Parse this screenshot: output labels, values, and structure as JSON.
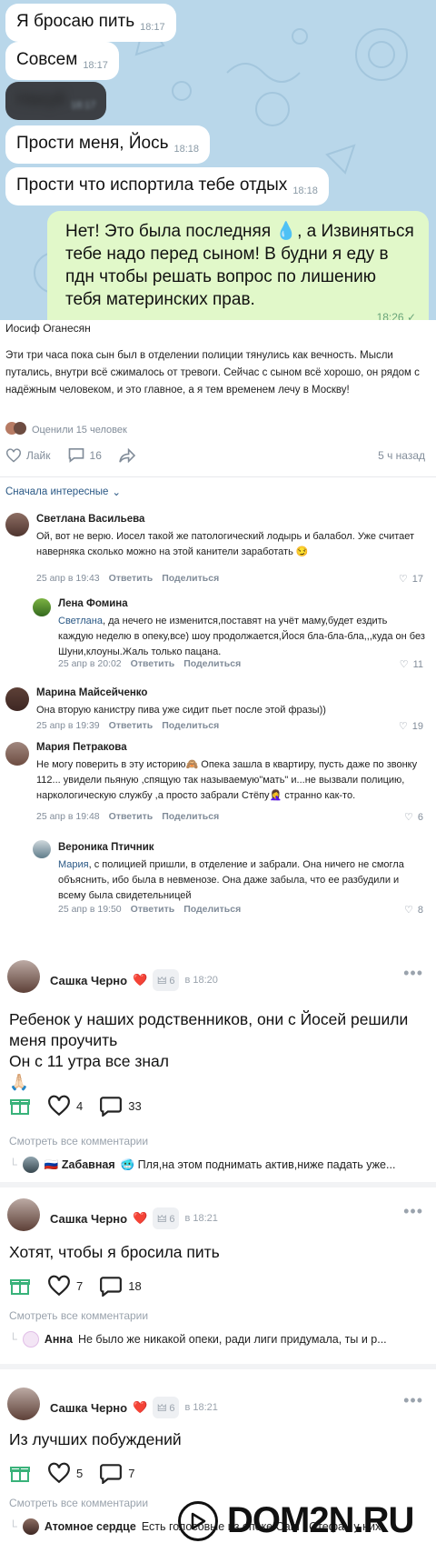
{
  "chat": {
    "messages": [
      {
        "text": "Я бросаю пить",
        "time": "18:17"
      },
      {
        "text": "Совсем",
        "time": "18:17"
      },
      {
        "text": "Нахуй",
        "time": "18:17",
        "blurred": true
      },
      {
        "text": "Прости меня, Йось",
        "time": "18:18"
      },
      {
        "text": "Прости что испортила тебе отдых",
        "time": "18:18"
      }
    ],
    "outgoing": {
      "text_part1": "Нет! Это была последняя ",
      "text_part2": ", а Извиняться тебе надо перед сыном! В будни я еду в пдн чтобы решать вопрос по лишению тебя материнских прав.",
      "time": "18:26 ✓"
    }
  },
  "vk_post": {
    "author": "Иосиф Оганесян",
    "text": "Эти три часа пока сын был в отделении полиции тянулись как вечность. Мысли путались, внутри всё сжималось от тревоги. Сейчас с сыном всё хорошо, он рядом с надёжным человеком, и это главное, а я тем временем лечу в Москву!",
    "rated": "Оценили 15 человек",
    "like_label": "Лайк",
    "comments_count": "16",
    "time": "5 ч назад",
    "sort_label": "Сначала интересные"
  },
  "comments": [
    {
      "name": "Светлана Васильева",
      "text": "Ой, вот не верю. Иосел такой же патологический лодырь и балабол. Уже считает наверняка сколько можно на этой канители заработать 😏",
      "date": "25 апр в 19:43",
      "reply": "Ответить",
      "share": "Поделиться",
      "likes": "17"
    },
    {
      "name": "Лена Фомина",
      "mention": "Светлана",
      "text": ", да нечего не изменится,поставят на учёт маму,будет ездить каждую неделю в опеку,все) шоу продолжается,Йося бла-бла-бла,,,куда он без Шуни,клоуны.Жаль только пацана.",
      "date": "25 апр в 20:02",
      "reply": "Ответить",
      "share": "Поделиться",
      "likes": "11"
    },
    {
      "name": "Марина Майсейченко",
      "text": "Она вторую канистру пива уже сидит пьет после этой фразы))",
      "date": "25 апр в 19:39",
      "reply": "Ответить",
      "share": "Поделиться",
      "likes": "19"
    },
    {
      "name": "Мария Петракова",
      "text": "Не могу поверить в эту историю🙈 Опека зашла в квартиру, пусть даже по звонку 112... увидели пьяную ,спящую так называемую\"мать\" и...не вызвали полицию, наркологическую службу ,а просто забрали Стёпу🤦‍♀️ странно как-то.",
      "date": "25 апр в 19:48",
      "reply": "Ответить",
      "share": "Поделиться",
      "likes": "6"
    },
    {
      "name": "Вероника Птичник",
      "mention": "Мария",
      "text": ", с полицией пришли, в отделение и забрали. Она ничего не смогла объяснить, ибо была в невменозе. Она даже забыла, что ее разбудили и всему была свидетельницей",
      "date": "25 апр в 19:50",
      "reply": "Ответить",
      "share": "Поделиться",
      "likes": "8"
    }
  ],
  "posts": [
    {
      "author": "Сашка Черно",
      "heart": "❤️",
      "badge": "6",
      "time": "в 18:20",
      "text": "Ребенок у наших родственников, они с Йосей решили меня проучить\nОн с 11 утра все знал\n🙏🏻",
      "likes": "4",
      "comments": "33",
      "see_all": "Смотреть все комментарии",
      "reply_name": "🇷🇺 Zaбавная",
      "reply_text": "🥶 Пля,на этом поднимать актив,ниже падать уже..."
    },
    {
      "author": "Сашка Черно",
      "heart": "❤️",
      "badge": "6",
      "time": "в 18:21",
      "text": "Хотят, чтобы я бросила пить",
      "likes": "7",
      "comments": "18",
      "see_all": "Смотреть все комментарии",
      "reply_name": "Анна",
      "reply_text": "Не было же никакой опеки, ради лиги придумала, ты и р..."
    },
    {
      "author": "Сашка Черно",
      "heart": "❤️",
      "badge": "6",
      "time": "в 18:21",
      "text": "Из лучших побуждений",
      "likes": "5",
      "comments": "7",
      "see_all": "Смотреть все комментарии",
      "reply_name": "Атомное сердце",
      "reply_text": "Есть голосовые из опеке Саш , Стефан у них"
    }
  ],
  "watermark": "DOM2N.RU",
  "colors": {
    "chat_bg": "#b9d7ea",
    "outgoing": "#e1f8c9",
    "link": "#2a5885",
    "muted": "#818c99"
  }
}
